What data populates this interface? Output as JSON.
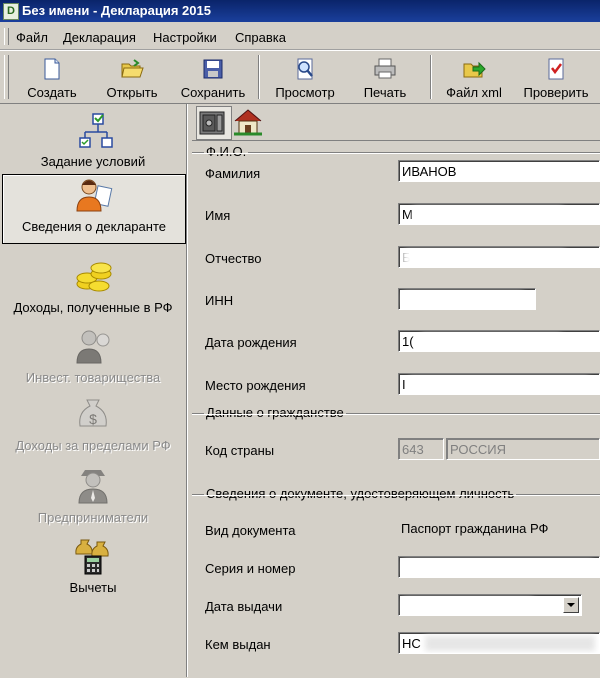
{
  "window": {
    "title": "Без имени - Декларация 2015",
    "app_icon": "D"
  },
  "menu": [
    "Файл",
    "Декларация",
    "Настройки",
    "Справка"
  ],
  "toolbar": {
    "create": "Создать",
    "open": "Открыть",
    "save": "Сохранить",
    "preview": "Просмотр",
    "print": "Печать",
    "xml": "Файл xml",
    "check": "Проверить"
  },
  "nav": {
    "conditions": "Задание условий",
    "declarant": "Сведения о декларанте",
    "income_rf": "Доходы, полученные в РФ",
    "invest": "Инвест. товарищества",
    "income_abroad": "Доходы за пределами РФ",
    "entrepreneurs": "Предприниматели",
    "deductions": "Вычеты"
  },
  "form": {
    "fio_group": "Ф.И.О.",
    "surname_label": "Фамилия",
    "surname_value": "ИВАНОВ",
    "name_label": "Имя",
    "name_value": "М",
    "patronymic_label": "Отчество",
    "patronymic_value": "Б",
    "inn_label": "ИНН",
    "birthdate_label": "Дата рождения",
    "birthdate_value": "1(",
    "birthplace_label": "Место рождения",
    "birthplace_value": "I",
    "citizenship_group": "Данные о гражданстве",
    "country_label": "Код страны",
    "country_code": "643",
    "country_name": "РОССИЯ",
    "document_group": "Сведения о документе, удостоверяющем личность",
    "doctype_label": "Вид документа",
    "doctype_value": "Паспорт гражданина РФ",
    "series_label": "Серия и номер",
    "issue_date_label": "Дата выдачи",
    "issued_by_label": "Кем выдан",
    "issued_by_value": "НС"
  }
}
